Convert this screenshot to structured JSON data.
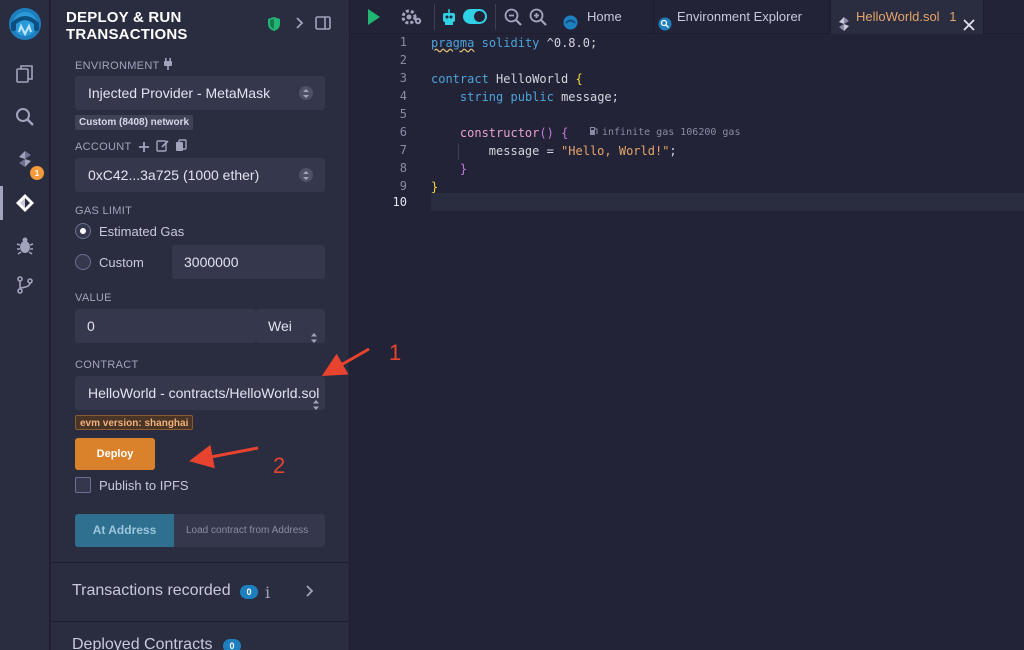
{
  "panel": {
    "title_line1": "DEPLOY & RUN",
    "title_line2": "TRANSACTIONS",
    "environment_label": "ENVIRONMENT",
    "environment_value": "Injected Provider - MetaMask",
    "network_tag": "Custom (8408) network",
    "account_label": "ACCOUNT",
    "account_value": "0xC42...3a725 (1000 ether)",
    "gas_limit_label": "GAS LIMIT",
    "gas_estimated": "Estimated Gas",
    "gas_custom": "Custom",
    "gas_custom_value": "3000000",
    "value_label": "VALUE",
    "value_amount": "0",
    "value_unit": "Wei",
    "contract_label": "CONTRACT",
    "contract_value": "HelloWorld - contracts/HelloWorld.sol",
    "evm_tag": "evm version: shanghai",
    "deploy_label": "Deploy",
    "publish_ipfs": "Publish to IPFS",
    "at_address_label": "At Address",
    "at_address_placeholder": "Load contract from Address",
    "transactions_recorded": "Transactions recorded",
    "transactions_count": "0",
    "deployed_contracts": "Deployed Contracts",
    "deployed_count": "0",
    "rail_badge": "1"
  },
  "tabs": {
    "home": "Home",
    "env_explorer": "Environment Explorer",
    "file": "HelloWorld.sol",
    "file_count": "1"
  },
  "editor": {
    "line_numbers": [
      "1",
      "2",
      "3",
      "4",
      "5",
      "6",
      "7",
      "8",
      "9",
      "10"
    ],
    "gas_hint": "infinite gas 106200 gas"
  },
  "annotations": {
    "step1": "1",
    "step2": "2"
  },
  "colors": {
    "accent_orange": "#d9822b",
    "annotation_red": "#e8432f",
    "badge_blue": "#1e7fbf",
    "toggle_cyan": "#2fd1e5"
  }
}
